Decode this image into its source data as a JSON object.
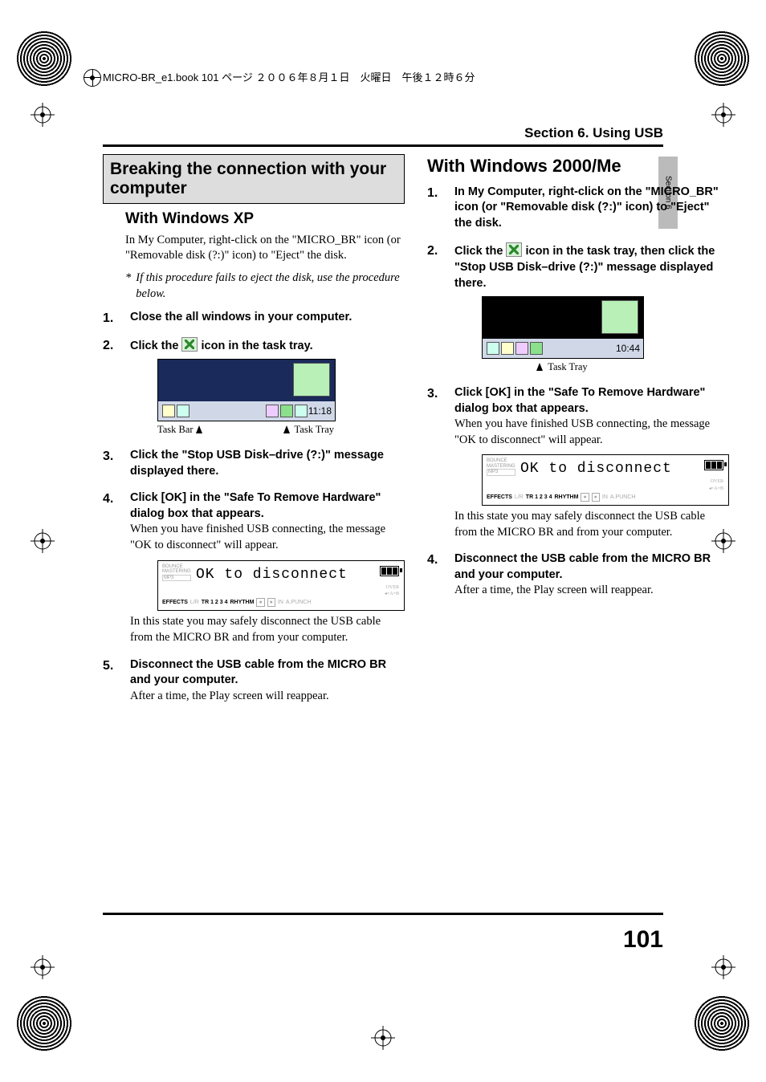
{
  "header_filename": "MICRO-BR_e1.book 101 ページ ２００６年８月１日　火曜日　午後１２時６分",
  "section_header": "Section 6. Using USB",
  "side_tab": "Section 6",
  "page_number": "101",
  "left": {
    "boxed_heading": "Breaking the connection with your computer",
    "sub_heading": "With Windows XP",
    "intro": "In My Computer, right-click on the \"MICRO_BR\" icon (or \"Removable disk (?:)\" icon) to \"Eject\" the disk.",
    "note_ast": "*",
    "note": "If this procedure fails to eject the disk, use the procedure below.",
    "steps": {
      "s1": "Close the all windows in your computer.",
      "s2_a": "Click the ",
      "s2_b": " icon in the task tray.",
      "fig1_label_left": "Task Bar",
      "fig1_label_right": "Task Tray",
      "fig1_clock": "11:18",
      "s3": "Click the \"Stop USB Disk–drive (?:)\" message displayed there.",
      "s4_bold": "Click [OK] in the \"Safe To Remove Hardware\" dialog box that appears.",
      "s4_body": "When you have finished USB connecting, the message \"OK to disconnect\" will appear.",
      "lcd_text": "OK to disconnect",
      "lcd_left1": "BOUNCE",
      "lcd_left2": "MASTERING",
      "lcd_left3": "MP3",
      "lcd_row2_eff": "EFFECTS",
      "lcd_row2_lr": "L/R",
      "lcd_row2_tr": "TR 1 2 3 4",
      "lcd_row2_rhy": "RHYTHM",
      "lcd_row2_in": "IN",
      "lcd_row2_ap": "A.PUNCH",
      "lcd_row2_over": "OVER",
      "lcd_row2_ab": "◂=A=B",
      "s4_after": "In this state you may safely disconnect the USB cable from the MICRO BR and from your computer.",
      "s5_bold": "Disconnect the USB cable from the MICRO BR and your computer.",
      "s5_body": "After a time, the Play screen will reappear."
    }
  },
  "right": {
    "heading": "With Windows 2000/Me",
    "steps": {
      "s1": "In My Computer, right-click on the \"MICRO_BR\" icon (or \"Removable disk (?:)\" icon) to \"Eject\" the disk.",
      "s2_a": "Click the ",
      "s2_b": " icon in the task tray, then click the \"Stop USB Disk–drive (?:)\" message displayed there.",
      "fig_label": "Task Tray",
      "fig_clock": "10:44",
      "s3_bold": "Click [OK] in the \"Safe To Remove Hardware\" dialog box that appears.",
      "s3_body": "When you have finished USB connecting, the message \"OK to disconnect\" will appear.",
      "lcd_text": "OK to disconnect",
      "s3_after": "In this state you may safely disconnect the USB cable from the MICRO BR and from your computer.",
      "s4_bold": "Disconnect the USB cable from the MICRO BR and your computer.",
      "s4_body": "After a time, the Play screen will reappear."
    }
  }
}
